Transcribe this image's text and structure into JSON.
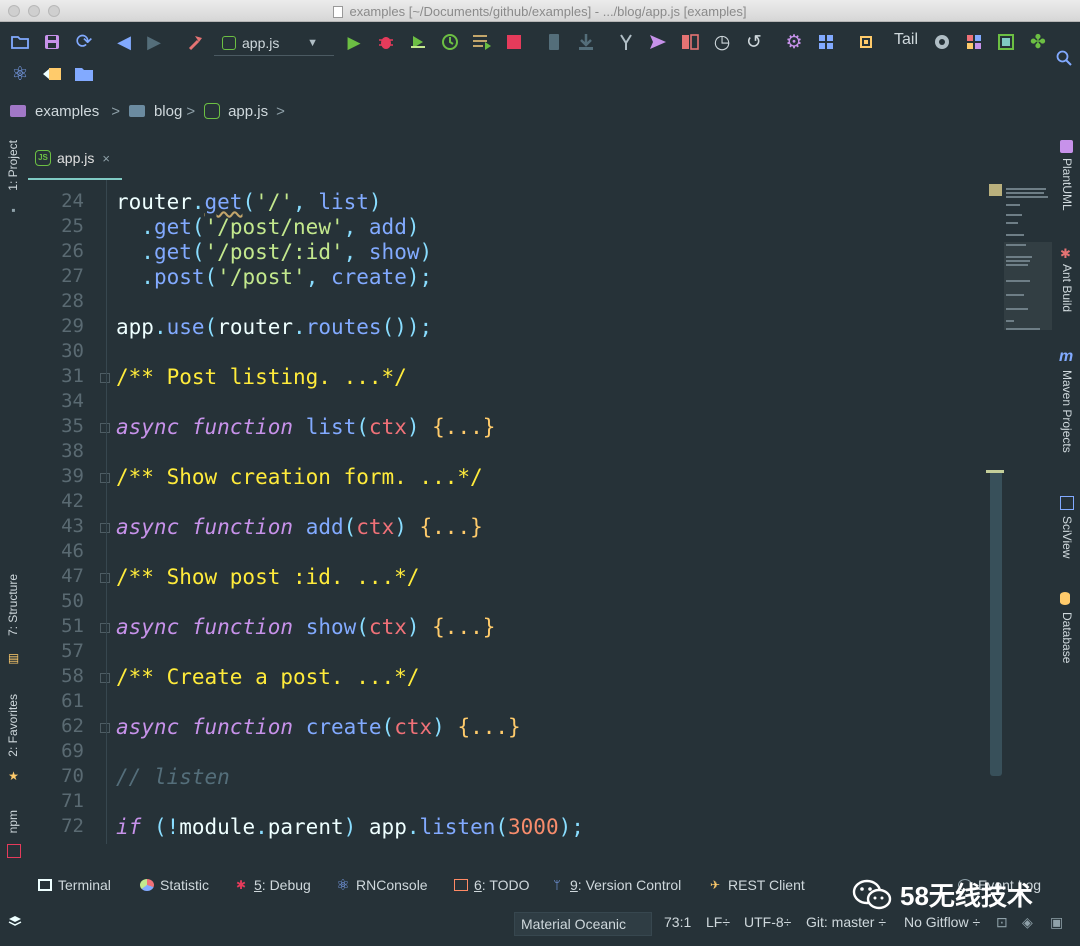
{
  "window": {
    "title": "examples [~/Documents/github/examples] - .../blog/app.js [examples]"
  },
  "toolbar": {
    "run_config": "app.js",
    "tail_label": "Tail",
    "icons": [
      "open-folder-icon",
      "save-icon",
      "sync-icon",
      "back-arrow-icon",
      "forward-arrow-icon",
      "build-hammer-icon",
      "run-icon",
      "debug-bug-icon",
      "run-coverage-icon",
      "profile-icon",
      "run-list-icon",
      "stop-icon",
      "vcs-update-icon",
      "vcs-commit-icon",
      "git-branch-icon",
      "send-icon",
      "compare-icon",
      "history-icon",
      "revert-icon",
      "settings-gear-icon",
      "structure-grid-icon",
      "plugin-chip-icon",
      "react-icon",
      "back-file-icon",
      "folder-icon",
      "search-icon"
    ]
  },
  "breadcrumb": {
    "items": [
      "examples",
      "blog",
      "app.js"
    ]
  },
  "tabs": [
    {
      "label": "app.js",
      "close": "×"
    }
  ],
  "left_tools": {
    "project": "1: Project",
    "structure": "7: Structure",
    "favorites": "2: Favorites",
    "npm": "npm"
  },
  "right_tools": {
    "plantuml": "PlantUML",
    "ant_build": "Ant Build",
    "maven": "Maven Projects",
    "sciview": "SciView",
    "database": "Database"
  },
  "editor": {
    "lines": [
      {
        "num": "24",
        "fold": false
      },
      {
        "num": "25",
        "fold": false
      },
      {
        "num": "26",
        "fold": false
      },
      {
        "num": "27",
        "fold": false
      },
      {
        "num": "28",
        "fold": false
      },
      {
        "num": "29",
        "fold": false
      },
      {
        "num": "30",
        "fold": false
      },
      {
        "num": "31",
        "fold": true
      },
      {
        "num": "34",
        "fold": false
      },
      {
        "num": "35",
        "fold": true
      },
      {
        "num": "38",
        "fold": false
      },
      {
        "num": "39",
        "fold": true
      },
      {
        "num": "42",
        "fold": false
      },
      {
        "num": "43",
        "fold": true
      },
      {
        "num": "46",
        "fold": false
      },
      {
        "num": "47",
        "fold": true
      },
      {
        "num": "50",
        "fold": false
      },
      {
        "num": "51",
        "fold": true
      },
      {
        "num": "57",
        "fold": false
      },
      {
        "num": "58",
        "fold": true
      },
      {
        "num": "61",
        "fold": false
      },
      {
        "num": "62",
        "fold": true
      },
      {
        "num": "69",
        "fold": false
      },
      {
        "num": "70",
        "fold": false
      },
      {
        "num": "71",
        "fold": false
      },
      {
        "num": "72",
        "fold": false
      }
    ],
    "code": {
      "l24": [
        "router",
        ".",
        "get",
        "(",
        "'/'",
        ", ",
        "list",
        ")"
      ],
      "l25": [
        "  .",
        "get",
        "(",
        "'/post/new'",
        ", ",
        "add",
        ")"
      ],
      "l26": [
        "  .",
        "get",
        "(",
        "'/post/:id'",
        ", ",
        "show",
        ")"
      ],
      "l27": [
        "  .",
        "post",
        "(",
        "'/post'",
        ", ",
        "create",
        ");"
      ],
      "l29": [
        "app",
        ".",
        "use",
        "(",
        "router",
        ".",
        "routes",
        "());"
      ],
      "l31": "/** Post listing. ...*/",
      "l35": [
        "async",
        " ",
        "function",
        " ",
        "list",
        "(",
        "ctx",
        ") ",
        "{...}"
      ],
      "l39": "/** Show creation form. ...*/",
      "l43": [
        "async",
        " ",
        "function",
        " ",
        "add",
        "(",
        "ctx",
        ") ",
        "{...}"
      ],
      "l47": "/** Show post :id. ...*/",
      "l51": [
        "async",
        " ",
        "function",
        " ",
        "show",
        "(",
        "ctx",
        ") ",
        "{...}"
      ],
      "l58": "/** Create a post. ...*/",
      "l62": [
        "async",
        " ",
        "function",
        " ",
        "create",
        "(",
        "ctx",
        ") ",
        "{...}"
      ],
      "l70": "// listen",
      "l72": [
        "if",
        " (!",
        "module",
        ".",
        "parent",
        ") ",
        "app",
        ".",
        "listen",
        "(",
        "3000",
        ");"
      ]
    }
  },
  "bottom_tools": [
    {
      "prefix": "",
      "label": "Terminal",
      "icon": "terminal-icon"
    },
    {
      "prefix": "",
      "label": "Statistic",
      "icon": "pie-chart-icon"
    },
    {
      "prefix": "5",
      "label": ": Debug",
      "icon": "bug-icon"
    },
    {
      "prefix": "",
      "label": "RNConsole",
      "icon": "react-icon"
    },
    {
      "prefix": "6",
      "label": ": TODO",
      "icon": "todo-icon"
    },
    {
      "prefix": "9",
      "label": ": Version Control",
      "icon": "branch-icon"
    },
    {
      "prefix": "",
      "label": "REST Client",
      "icon": "rest-icon"
    },
    {
      "prefix": "",
      "label": "Event Log",
      "icon": "event-log-icon"
    }
  ],
  "status": {
    "theme": "Material Oceanic",
    "position": "73:1",
    "line_sep": "LF÷",
    "encoding": "UTF-8÷",
    "git": "Git: master ÷",
    "gitflow": "No Gitflow ÷"
  },
  "watermark": {
    "text": "58无线技术"
  },
  "colors": {
    "background": "#263238",
    "accent": "#80cbc4",
    "keyword": "#c792ea",
    "function": "#82aaff",
    "string": "#c3e88d",
    "parameter": "#f07178",
    "number": "#f78c6c",
    "doc_comment": "#ffeb3b",
    "line_comment": "#546e7a"
  }
}
